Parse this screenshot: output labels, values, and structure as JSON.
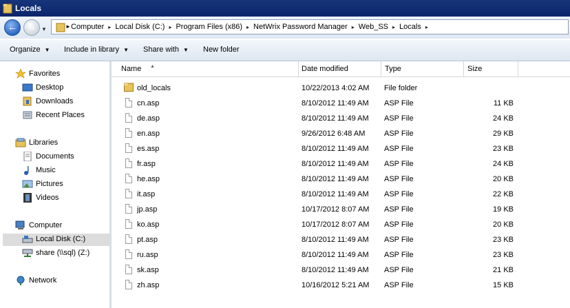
{
  "window": {
    "title": "Locals"
  },
  "address": {
    "crumbs": [
      "Computer",
      "Local Disk (C:)",
      "Program Files (x86)",
      "NetWrix Password Manager",
      "Web_SS",
      "Locals"
    ]
  },
  "toolbar": {
    "organize": "Organize",
    "include": "Include in library",
    "share": "Share with",
    "newfolder": "New folder"
  },
  "nav": {
    "favorites": "Favorites",
    "desktop": "Desktop",
    "downloads": "Downloads",
    "recent": "Recent Places",
    "libraries": "Libraries",
    "documents": "Documents",
    "music": "Music",
    "pictures": "Pictures",
    "videos": "Videos",
    "computer": "Computer",
    "localdisk": "Local Disk (C:)",
    "share": "share (\\\\sql) (Z:)",
    "network": "Network"
  },
  "columns": {
    "name": "Name",
    "date": "Date modified",
    "type": "Type",
    "size": "Size"
  },
  "files": [
    {
      "name": "old_locals",
      "date": "10/22/2013 4:02 AM",
      "type": "File folder",
      "size": "",
      "kind": "folder"
    },
    {
      "name": "cn.asp",
      "date": "8/10/2012 11:49 AM",
      "type": "ASP File",
      "size": "11 KB",
      "kind": "file"
    },
    {
      "name": "de.asp",
      "date": "8/10/2012 11:49 AM",
      "type": "ASP File",
      "size": "24 KB",
      "kind": "file"
    },
    {
      "name": "en.asp",
      "date": "9/26/2012 6:48 AM",
      "type": "ASP File",
      "size": "29 KB",
      "kind": "file"
    },
    {
      "name": "es.asp",
      "date": "8/10/2012 11:49 AM",
      "type": "ASP File",
      "size": "23 KB",
      "kind": "file"
    },
    {
      "name": "fr.asp",
      "date": "8/10/2012 11:49 AM",
      "type": "ASP File",
      "size": "24 KB",
      "kind": "file"
    },
    {
      "name": "he.asp",
      "date": "8/10/2012 11:49 AM",
      "type": "ASP File",
      "size": "20 KB",
      "kind": "file"
    },
    {
      "name": "it.asp",
      "date": "8/10/2012 11:49 AM",
      "type": "ASP File",
      "size": "22 KB",
      "kind": "file"
    },
    {
      "name": "jp.asp",
      "date": "10/17/2012 8:07 AM",
      "type": "ASP File",
      "size": "19 KB",
      "kind": "file"
    },
    {
      "name": "ko.asp",
      "date": "10/17/2012 8:07 AM",
      "type": "ASP File",
      "size": "20 KB",
      "kind": "file"
    },
    {
      "name": "pt.asp",
      "date": "8/10/2012 11:49 AM",
      "type": "ASP File",
      "size": "23 KB",
      "kind": "file"
    },
    {
      "name": "ru.asp",
      "date": "8/10/2012 11:49 AM",
      "type": "ASP File",
      "size": "23 KB",
      "kind": "file"
    },
    {
      "name": "sk.asp",
      "date": "8/10/2012 11:49 AM",
      "type": "ASP File",
      "size": "21 KB",
      "kind": "file"
    },
    {
      "name": "zh.asp",
      "date": "10/16/2012 5:21 AM",
      "type": "ASP File",
      "size": "15 KB",
      "kind": "file"
    }
  ]
}
